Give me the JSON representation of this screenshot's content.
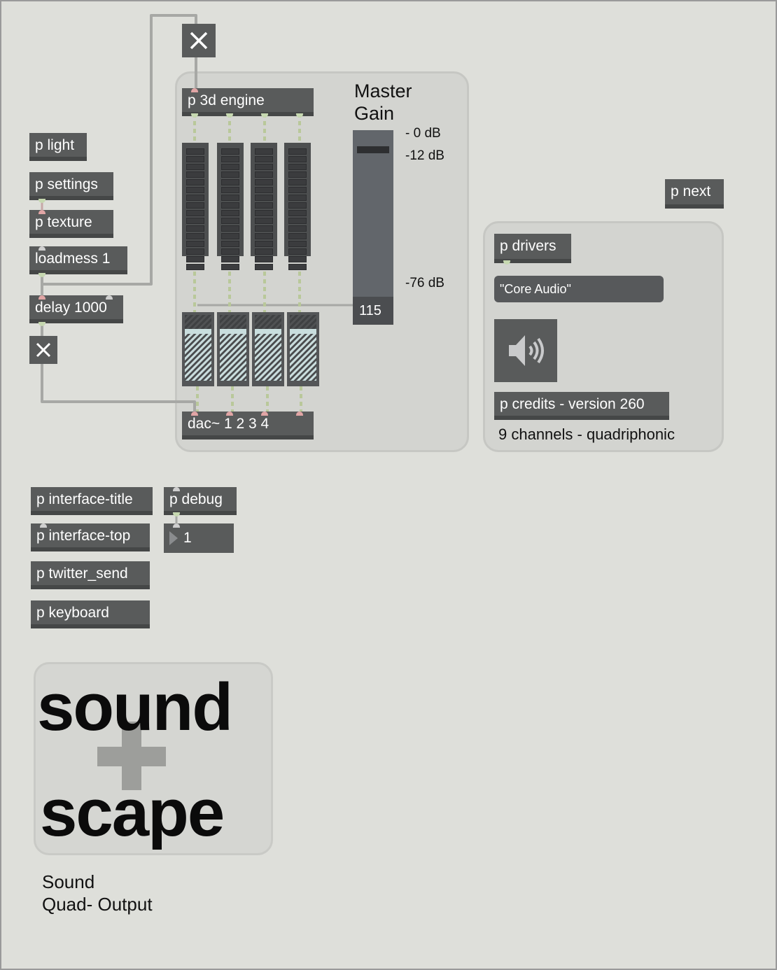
{
  "objects": {
    "p_light": "p light",
    "p_settings": "p settings",
    "p_texture": "p texture",
    "loadmess": "loadmess 1",
    "delay": "delay 1000",
    "engine": "p 3d engine",
    "dac": "dac~ 1 2 3 4",
    "p_next": "p next",
    "p_drivers": "p drivers",
    "p_credits": "p credits - version 260",
    "p_interface_title": "p interface-title",
    "p_debug": "p debug",
    "p_interface_top": "p interface-top",
    "p_twitter_send": "p twitter_send",
    "p_keyboard": "p keyboard"
  },
  "master_gain": {
    "title_line1": "Master",
    "title_line2": "Gain",
    "scale_top": "- 0 dB",
    "scale_mid": "-12 dB",
    "scale_bottom": "-76 dB",
    "value": "115"
  },
  "audio": {
    "driver_menu": "\"Core Audio\"",
    "channels_text": "9 channels - quadriphonic",
    "dac_icon": "speaker-icon"
  },
  "debug_number": "1",
  "logo": {
    "word1": "sound",
    "word2": "scape",
    "symbol": "plus"
  },
  "caption": {
    "line1": "Sound",
    "line2": "Quad- Output"
  },
  "colors": {
    "canvas": "#dedfda",
    "object": "#595b5b",
    "panel": "#d3d4d0",
    "cable": "#9fa09d",
    "signal_cable": "#c6d6a8"
  }
}
